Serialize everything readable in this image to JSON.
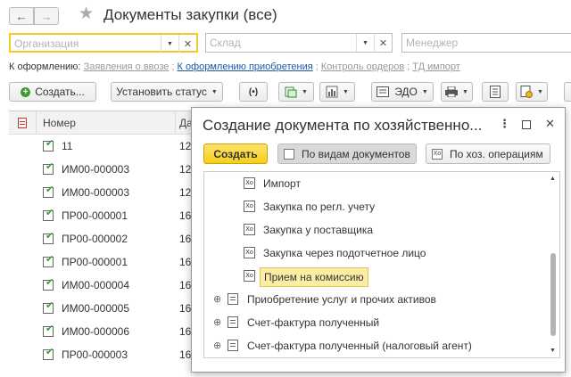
{
  "window": {
    "title": "Документы закупки (все)",
    "back_label": "←",
    "forward_label": "→",
    "favorite_icon": "star-icon"
  },
  "filters": {
    "organization": {
      "placeholder": "Организация",
      "value": ""
    },
    "warehouse": {
      "placeholder": "Склад",
      "value": ""
    },
    "manager": {
      "placeholder": "Менеджер",
      "value": ""
    }
  },
  "quick_links": {
    "label": "К оформлению:",
    "items": [
      {
        "label": "Заявления о ввозе",
        "active": false
      },
      {
        "label": "К оформлению приобретения",
        "active": true
      },
      {
        "label": "Контроль ордеров",
        "active": false
      },
      {
        "label": "ТД импорт",
        "active": false
      }
    ]
  },
  "toolbar": {
    "create_label": "Создать...",
    "set_status_label": "Установить статус",
    "edo_label": "ЭДО"
  },
  "table": {
    "columns": [
      "Номер",
      "Дат"
    ],
    "rows": [
      {
        "number": "11",
        "date": "12."
      },
      {
        "number": "ИМ00-000003",
        "date": "12."
      },
      {
        "number": "ИМ00-000003",
        "date": "12."
      },
      {
        "number": "ПР00-000001",
        "date": "16."
      },
      {
        "number": "ПР00-000002",
        "date": "16."
      },
      {
        "number": "ПР00-000001",
        "date": "16."
      },
      {
        "number": "ИМ00-000004",
        "date": "16."
      },
      {
        "number": "ИМ00-000005",
        "date": "16."
      },
      {
        "number": "ИМ00-000006",
        "date": "16."
      },
      {
        "number": "ПР00-000003",
        "date": "16."
      }
    ]
  },
  "dialog": {
    "title": "Создание документа по хозяйственно...",
    "create_label": "Создать",
    "by_doc_types_label": "По видам документов",
    "by_operations_label": "По хоз. операциям",
    "items": [
      {
        "label": "Импорт",
        "type": "operation",
        "selected": false
      },
      {
        "label": "Закупка по регл. учету",
        "type": "operation",
        "selected": false
      },
      {
        "label": "Закупка у поставщика",
        "type": "operation",
        "selected": false
      },
      {
        "label": "Закупка через подотчетное лицо",
        "type": "operation",
        "selected": false
      },
      {
        "label": "Прием на комиссию",
        "type": "operation",
        "selected": true
      },
      {
        "label": "Приобретение услуг и прочих активов",
        "type": "group",
        "selected": false
      },
      {
        "label": "Счет-фактура полученный",
        "type": "group",
        "selected": false
      },
      {
        "label": "Счет-фактура полученный (налоговый агент)",
        "type": "group",
        "selected": false
      }
    ]
  },
  "colors": {
    "accent_yellow": "#f6cf1a",
    "link_blue": "#1b57a8",
    "selection": "#fbeea4",
    "check_green": "#3aa035"
  }
}
